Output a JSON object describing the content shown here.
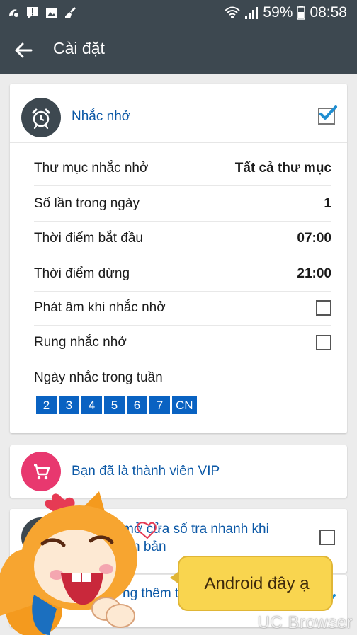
{
  "status_bar": {
    "icons_left": [
      "uc-browser-icon",
      "alert-icon",
      "image-icon",
      "broom-icon"
    ],
    "icons_right": [
      "wifi-icon",
      "signal-icon",
      "battery-icon"
    ],
    "battery": "59%",
    "time": "08:58"
  },
  "app_bar": {
    "title": "Cài đặt",
    "back_icon": "arrow-left-icon"
  },
  "reminder": {
    "title": "Nhắc nhở",
    "enabled": true,
    "rows": [
      {
        "label": "Thư mục nhắc nhở",
        "value": "Tất cả thư mục"
      },
      {
        "label": "Số lần trong ngày",
        "value": "1"
      },
      {
        "label": "Thời điểm bắt đầu",
        "value": "07:00"
      },
      {
        "label": "Thời điểm dừng",
        "value": "21:00"
      }
    ],
    "toggles": [
      {
        "label": "Phát âm khi nhắc nhở",
        "checked": false
      },
      {
        "label": "Rung nhắc nhở",
        "checked": false
      }
    ],
    "weekdays_label": "Ngày nhắc trong tuần",
    "weekdays": [
      "2",
      "3",
      "4",
      "5",
      "6",
      "7",
      "CN"
    ]
  },
  "vip": {
    "label": "Bạn đã là thành viên VIP",
    "icon": "cart-icon"
  },
  "quick_window": {
    "label_part1": "mở cửa sổ tra nhanh khi",
    "label_part2": "n bản",
    "checked": false
  },
  "add_word": {
    "label": "ng thêm từ",
    "checked": true
  },
  "overlay": {
    "bubble_text": "Android đây ạ",
    "watermark": "UC Browser"
  },
  "colors": {
    "appbar": "#3d4850",
    "accent_blue": "#0b58a6",
    "day_chip": "#0962c2",
    "vip_pink": "#e8386f",
    "bubble": "#f9d54f"
  }
}
